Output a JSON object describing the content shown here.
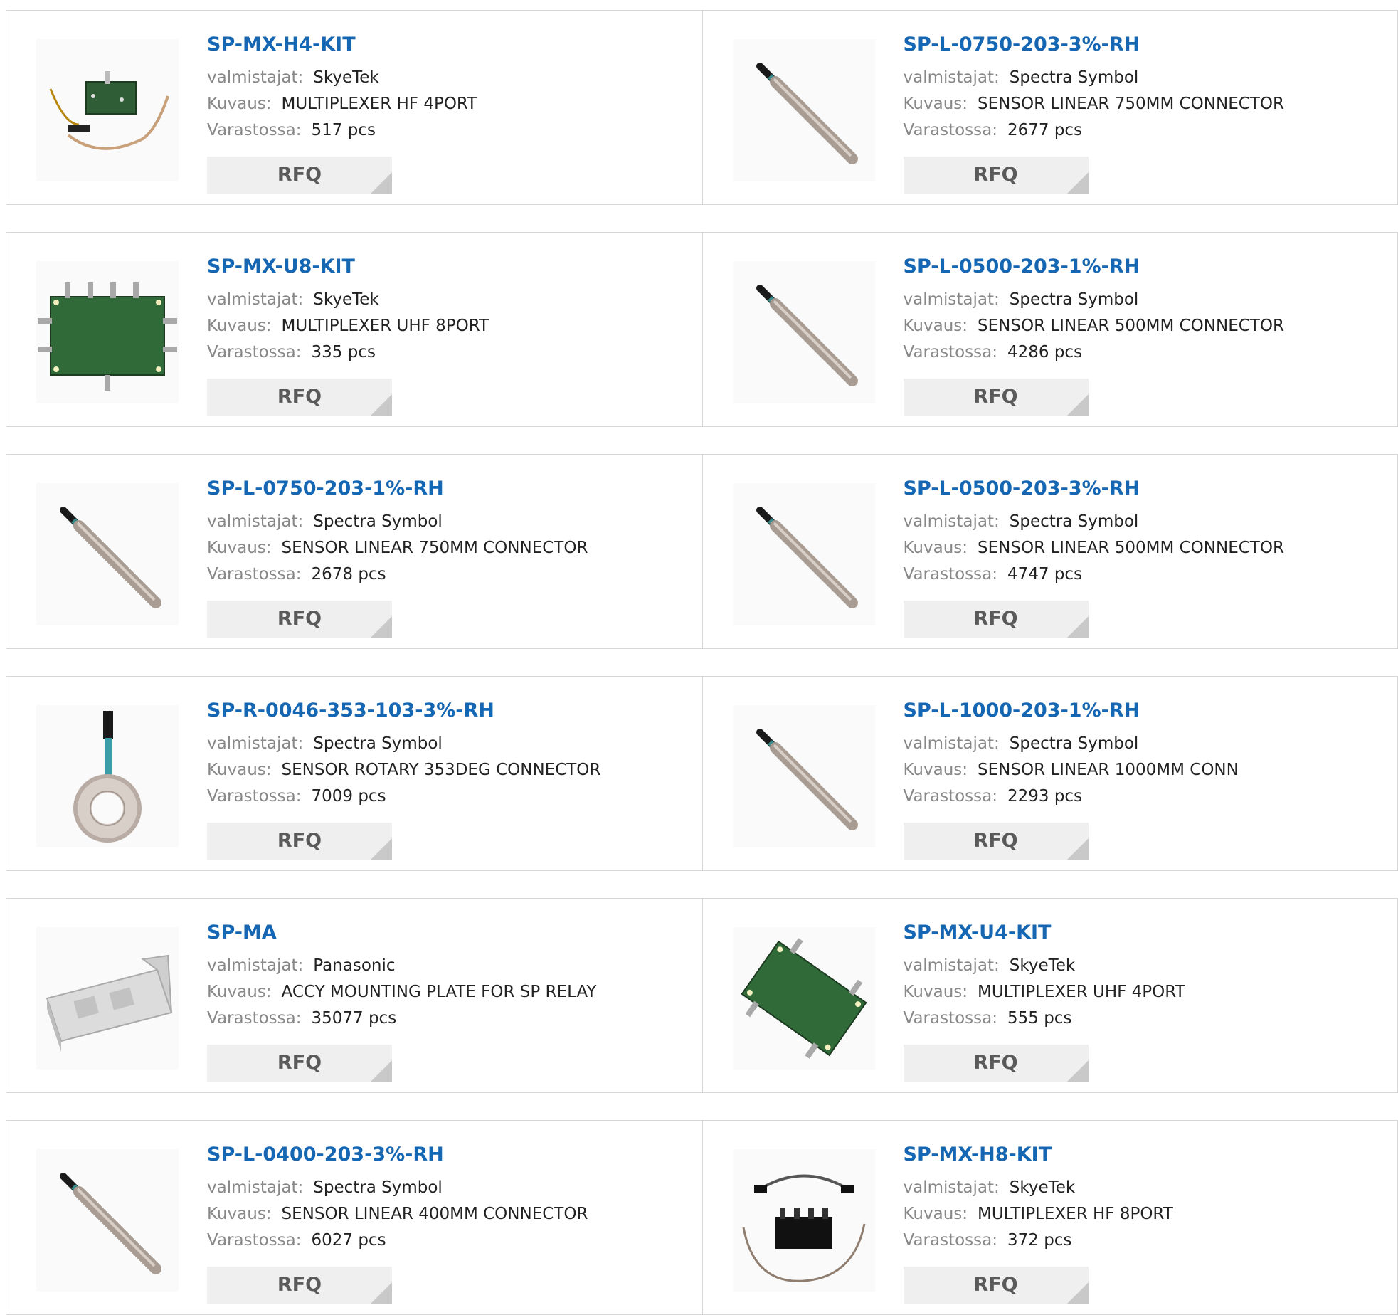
{
  "labels": {
    "manufacturer": "valmistajat:",
    "description": "Kuvaus:",
    "stock": "Varastossa:",
    "rfq": "RFQ"
  },
  "products": [
    {
      "part": "SP-MX-H4-KIT",
      "manufacturer": "SkyeTek",
      "description": "MULTIPLEXER HF 4PORT",
      "stock": "517 pcs",
      "image": "hf-multiplexer-4port"
    },
    {
      "part": "SP-L-0750-203-3%-RH",
      "manufacturer": "Spectra Symbol",
      "description": "SENSOR LINEAR 750MM CONNECTOR",
      "stock": "2677 pcs",
      "image": "linear-sensor"
    },
    {
      "part": "SP-MX-U8-KIT",
      "manufacturer": "SkyeTek",
      "description": "MULTIPLEXER UHF 8PORT",
      "stock": "335 pcs",
      "image": "uhf-multiplexer-8port"
    },
    {
      "part": "SP-L-0500-203-1%-RH",
      "manufacturer": "Spectra Symbol",
      "description": "SENSOR LINEAR 500MM CONNECTOR",
      "stock": "4286 pcs",
      "image": "linear-sensor"
    },
    {
      "part": "SP-L-0750-203-1%-RH",
      "manufacturer": "Spectra Symbol",
      "description": "SENSOR LINEAR 750MM CONNECTOR",
      "stock": "2678 pcs",
      "image": "linear-sensor"
    },
    {
      "part": "SP-L-0500-203-3%-RH",
      "manufacturer": "Spectra Symbol",
      "description": "SENSOR LINEAR 500MM CONNECTOR",
      "stock": "4747 pcs",
      "image": "linear-sensor"
    },
    {
      "part": "SP-R-0046-353-103-3%-RH",
      "manufacturer": "Spectra Symbol",
      "description": "SENSOR ROTARY 353DEG CONNECTOR",
      "stock": "7009 pcs",
      "image": "rotary-sensor"
    },
    {
      "part": "SP-L-1000-203-1%-RH",
      "manufacturer": "Spectra Symbol",
      "description": "SENSOR LINEAR 1000MM CONN",
      "stock": "2293 pcs",
      "image": "linear-sensor"
    },
    {
      "part": "SP-MA",
      "manufacturer": "Panasonic",
      "description": "ACCY MOUNTING PLATE FOR SP RELAY",
      "stock": "35077 pcs",
      "image": "mounting-plate"
    },
    {
      "part": "SP-MX-U4-KIT",
      "manufacturer": "SkyeTek",
      "description": "MULTIPLEXER UHF 4PORT",
      "stock": "555 pcs",
      "image": "uhf-multiplexer-4port"
    },
    {
      "part": "SP-L-0400-203-3%-RH",
      "manufacturer": "Spectra Symbol",
      "description": "SENSOR LINEAR 400MM CONNECTOR",
      "stock": "6027 pcs",
      "image": "linear-sensor"
    },
    {
      "part": "SP-MX-H8-KIT",
      "manufacturer": "SkyeTek",
      "description": "MULTIPLEXER HF 8PORT",
      "stock": "372 pcs",
      "image": "hf-multiplexer-8port"
    }
  ],
  "colors": {
    "link": "#1667b3",
    "label": "#888888",
    "rfq_bg": "#efefef",
    "border": "#d6d6d6"
  }
}
